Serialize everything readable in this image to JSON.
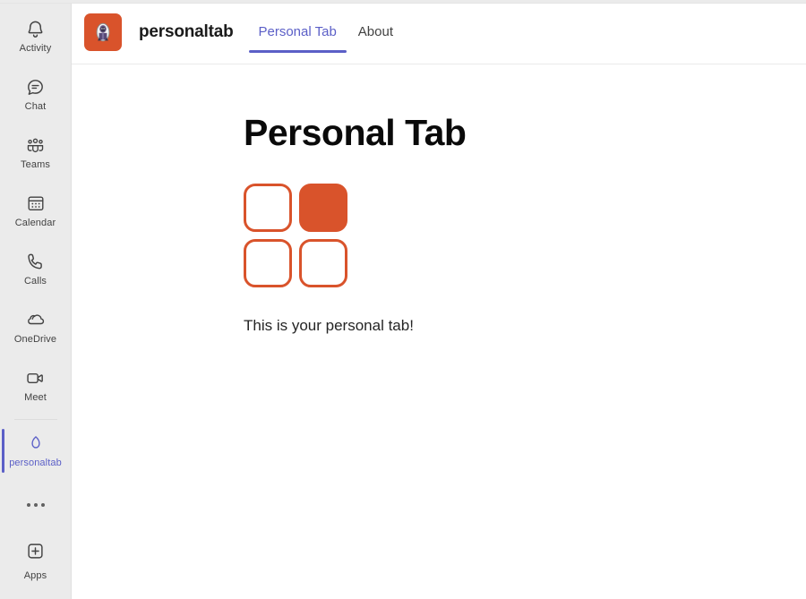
{
  "rail": {
    "items": [
      {
        "label": "Activity",
        "icon": "bell-icon",
        "active": false
      },
      {
        "label": "Chat",
        "icon": "chat-icon",
        "active": false
      },
      {
        "label": "Teams",
        "icon": "teams-people-icon",
        "active": false
      },
      {
        "label": "Calendar",
        "icon": "calendar-icon",
        "active": false
      },
      {
        "label": "Calls",
        "icon": "phone-icon",
        "active": false
      },
      {
        "label": "OneDrive",
        "icon": "cloud-icon",
        "active": false
      },
      {
        "label": "Meet",
        "icon": "video-camera-icon",
        "active": false
      },
      {
        "label": "personaltab",
        "icon": "personaltab-egg-icon",
        "active": true
      }
    ],
    "more_icon": "more-options-icon",
    "apps": {
      "label": "Apps",
      "icon": "apps-plus-icon"
    }
  },
  "header": {
    "logo_icon": "personaltab-app-logo-icon",
    "title": "personaltab",
    "tabs": [
      {
        "label": "Personal Tab",
        "active": true
      },
      {
        "label": "About",
        "active": false
      }
    ]
  },
  "main": {
    "heading": "Personal Tab",
    "logo_icon": "hello-world-squares-icon",
    "body_text": "This is your personal tab!"
  },
  "colors": {
    "accent_purple": "#5b5fc7",
    "brand_orange": "#d9532b",
    "rail_background": "#ebebeb",
    "content_background": "#ffffff",
    "text_primary": "#242424"
  }
}
